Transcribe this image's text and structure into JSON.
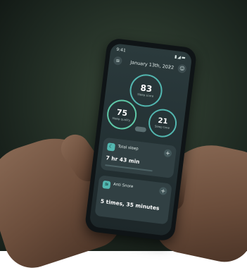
{
  "status": {
    "time": "9:41",
    "icons": "▮◢▬"
  },
  "header": {
    "date": "January 13th, 2022",
    "chevron": "⌄"
  },
  "rings": [
    {
      "value": "83",
      "label": "Sleep score"
    },
    {
      "value": "75",
      "label": "Sleep quality"
    },
    {
      "value": "21",
      "label": "Sleep time"
    }
  ],
  "cards": {
    "total_sleep": {
      "title": "Total sleep",
      "value": "7 hr 43 min"
    },
    "anti_snore": {
      "title": "Anti Snore",
      "value": "5 times, 35 minutes"
    }
  },
  "colors": {
    "accent": "#53b7b0",
    "screen": "#2b3a3c"
  }
}
